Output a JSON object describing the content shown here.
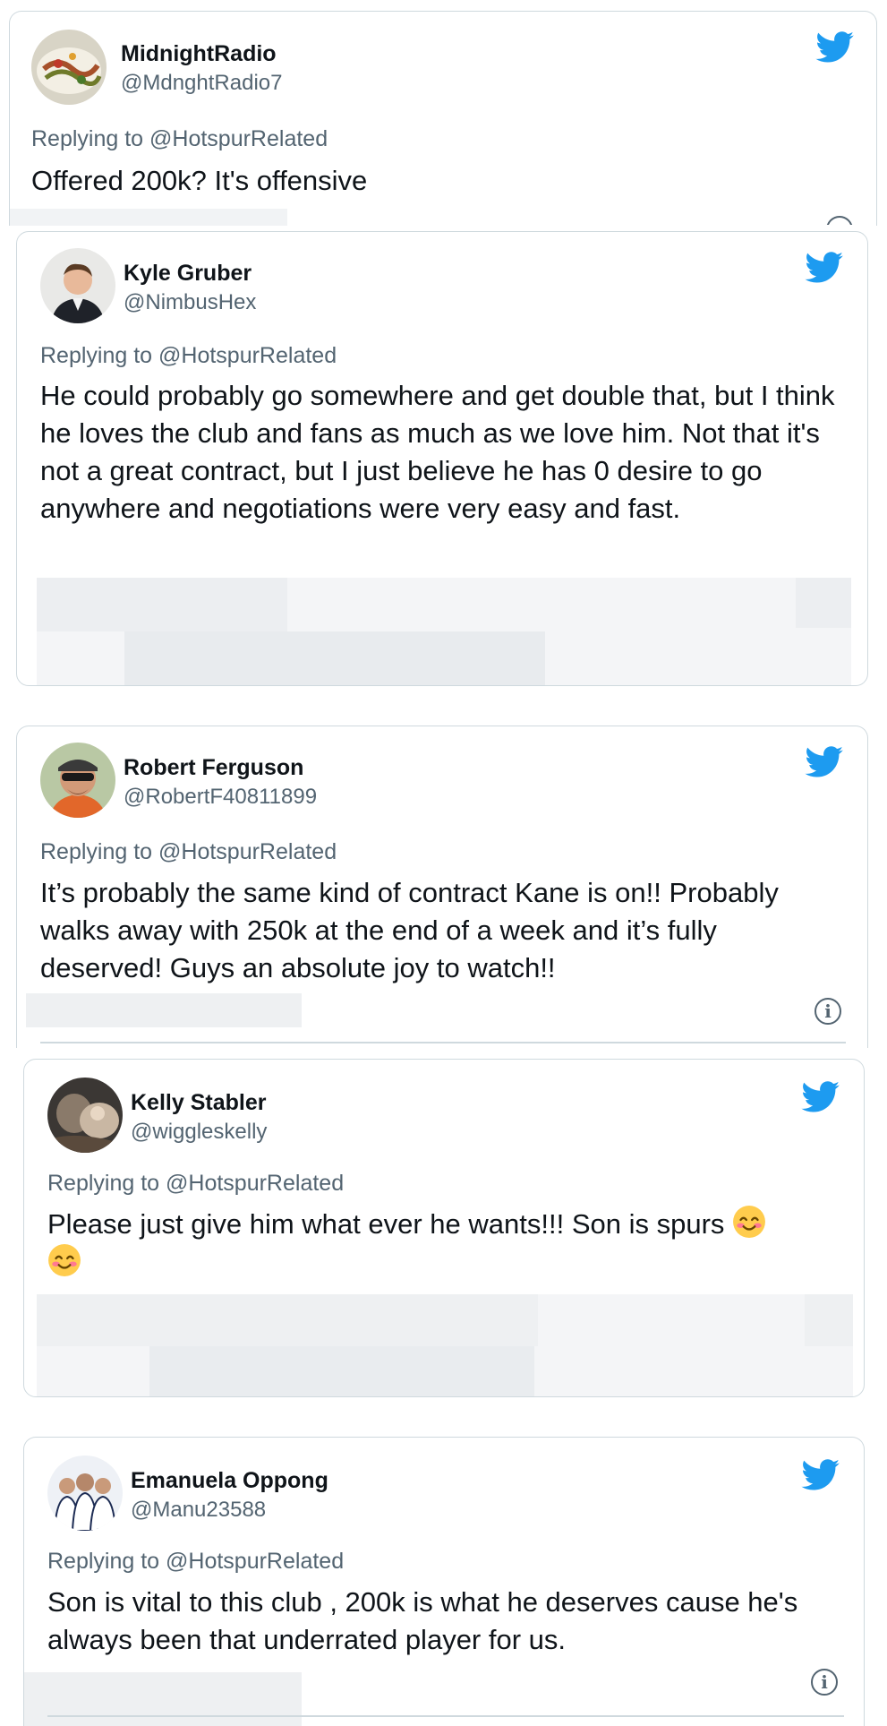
{
  "colors": {
    "twitter_blue": "#1d9bf0",
    "secondary_text": "#536471",
    "primary_text": "#0f1419",
    "border": "#cfd9de"
  },
  "icons": {
    "brand": "twitter-bird-icon",
    "info": "info-icon",
    "emoji": "smiling-face-with-smiling-eyes-emoji"
  },
  "tweets": [
    {
      "name": "MidnightRadio",
      "handle": "@MdnghtRadio7",
      "replying_to": "Replying to @HotspurRelated",
      "text": "Offered 200k? It's offensive"
    },
    {
      "name": "Kyle Gruber",
      "handle": "@NimbusHex",
      "replying_to": "Replying to @HotspurRelated",
      "text": "He could probably go somewhere and get double that, but I think he loves the club and fans as much as we love him. Not that it's not a great contract, but I just believe he has 0 desire to go anywhere and negotiations were very easy and fast."
    },
    {
      "name": "Robert Ferguson",
      "handle": "@RobertF40811899",
      "replying_to": "Replying to @HotspurRelated",
      "text": "It’s probably the same kind of contract Kane is on!! Probably walks away with 250k at the end of a week and it’s fully deserved! Guys an absolute joy to watch!!"
    },
    {
      "name": "Kelly Stabler",
      "handle": "@wiggleskelly",
      "replying_to": "Replying to @HotspurRelated",
      "text": "Please just give him what ever he wants!!! Son is spurs"
    },
    {
      "name": "Emanuela Oppong",
      "handle": "@Manu23588",
      "replying_to": "Replying to @HotspurRelated",
      "text": "Son is vital to this club , 200k is what he deserves cause he's always been that underrated player for us."
    }
  ]
}
